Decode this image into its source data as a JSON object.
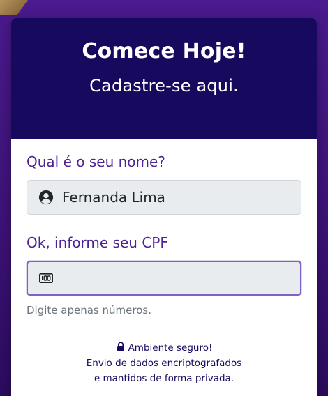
{
  "header": {
    "title": "Comece Hoje!",
    "subtitle": "Cadastre-se aqui."
  },
  "form": {
    "name_question": "Qual é o seu nome?",
    "name_value": "Fernanda Lima",
    "cpf_question": "Ok, informe seu CPF",
    "cpf_value": "",
    "cpf_hint": "Digite apenas números."
  },
  "security": {
    "line1": "Ambiente seguro!",
    "line2": "Envio de dados encriptografados",
    "line3": "e mantidos de forma privada."
  },
  "icons": {
    "name_field": "user-circle-icon",
    "cpf_field": "id-card-icon",
    "security": "lock-icon"
  },
  "colors": {
    "header_bg": "#170a5e",
    "accent": "#4c2295",
    "page_bg": "#3c1276",
    "focus_border": "#7b61c9"
  }
}
